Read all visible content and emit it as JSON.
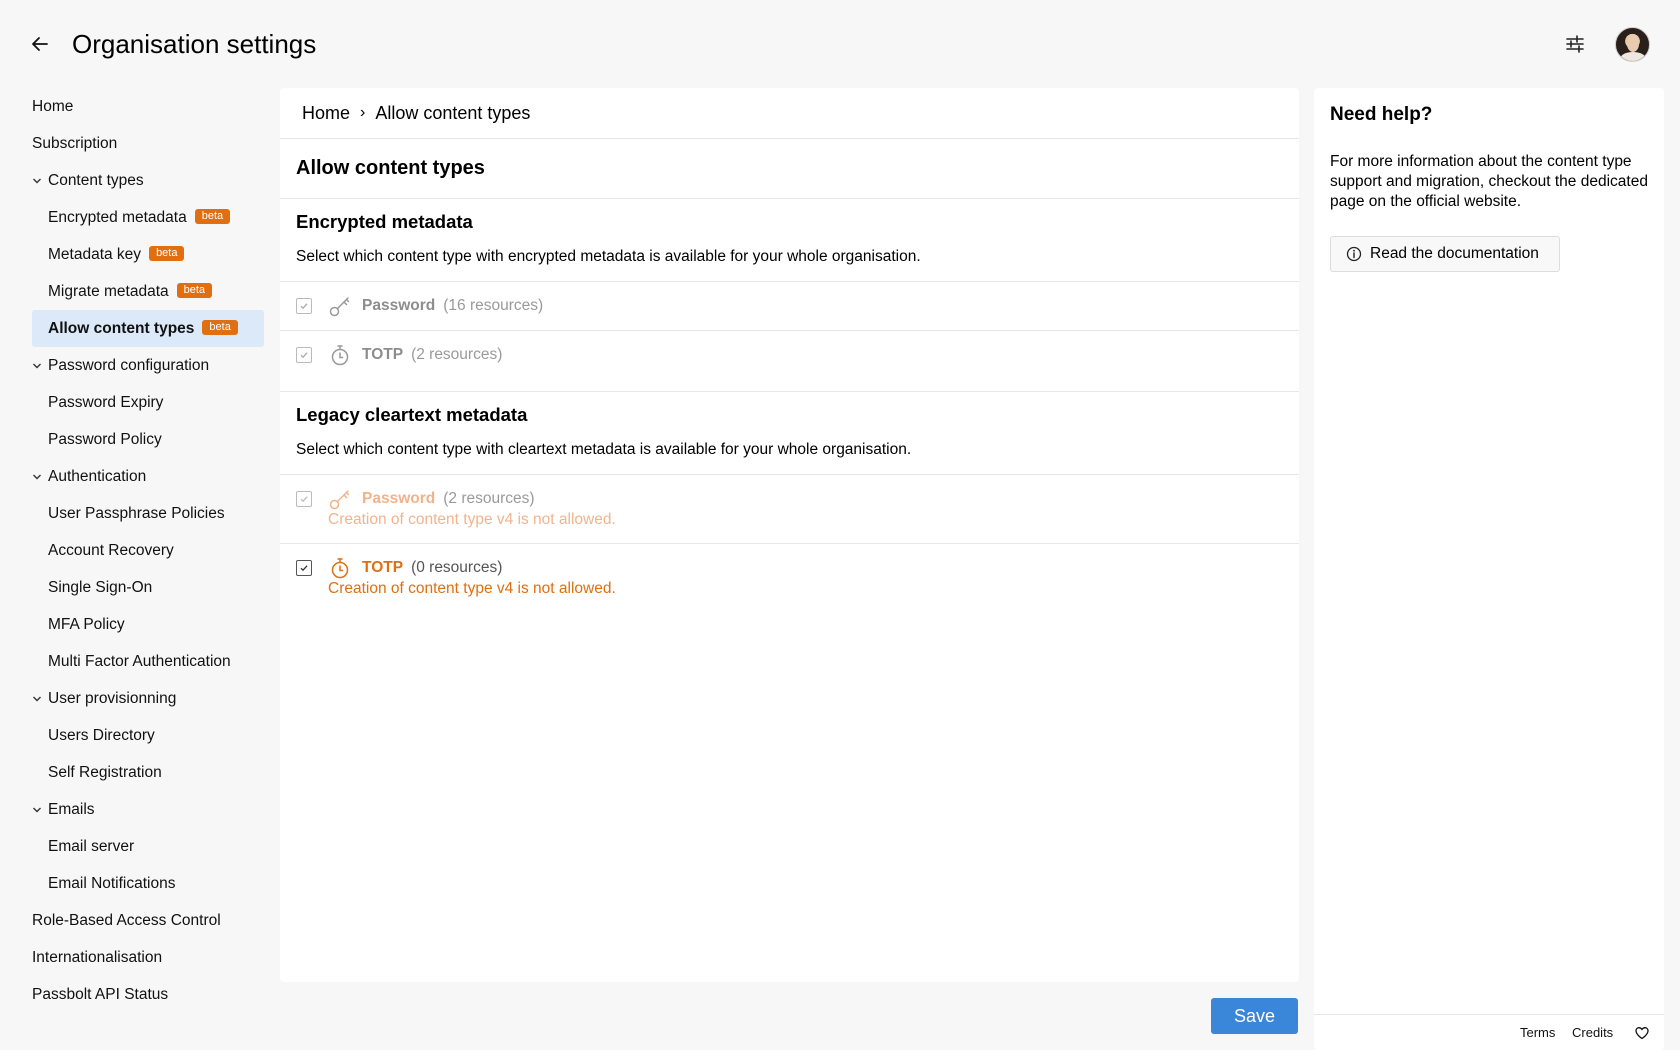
{
  "header": {
    "title": "Organisation settings"
  },
  "sidebar": {
    "home": "Home",
    "subscription": "Subscription",
    "content_types": {
      "label": "Content types",
      "items": [
        {
          "label": "Encrypted metadata",
          "badge": "beta"
        },
        {
          "label": "Metadata key",
          "badge": "beta"
        },
        {
          "label": "Migrate metadata",
          "badge": "beta"
        },
        {
          "label": "Allow content types",
          "badge": "beta",
          "active": true
        }
      ]
    },
    "password_configuration": {
      "label": "Password configuration",
      "items": [
        "Password Expiry",
        "Password Policy"
      ]
    },
    "authentication": {
      "label": "Authentication",
      "items": [
        "User Passphrase Policies",
        "Account Recovery",
        "Single Sign-On",
        "MFA Policy",
        "Multi Factor Authentication"
      ]
    },
    "user_provisionning": {
      "label": "User provisionning",
      "items": [
        "Users Directory",
        "Self Registration"
      ]
    },
    "emails": {
      "label": "Emails",
      "items": [
        "Email server",
        "Email Notifications"
      ]
    },
    "rbac": "Role-Based Access Control",
    "internationalisation": "Internationalisation",
    "api_status": "Passbolt API Status"
  },
  "main": {
    "breadcrumb": {
      "home": "Home",
      "separator": "›",
      "current": "Allow content types"
    },
    "title": "Allow content types",
    "encrypted": {
      "heading": "Encrypted metadata",
      "description": "Select which content type with encrypted metadata is available for your whole organisation.",
      "password": {
        "label": "Password",
        "count": "(16 resources)"
      },
      "totp": {
        "label": "TOTP",
        "count": "(2 resources)"
      }
    },
    "legacy": {
      "heading": "Legacy cleartext metadata",
      "description": "Select which content type with cleartext metadata is available for your whole organisation.",
      "password": {
        "label": "Password",
        "count": "(2 resources)",
        "error": "Creation of content type v4 is not allowed."
      },
      "totp": {
        "label": "TOTP",
        "count": "(0 resources)",
        "error": "Creation of content type v4 is not allowed."
      }
    }
  },
  "help": {
    "title": "Need help?",
    "text": "For more information about the content type support and migration, checkout the dedicated page on the official website.",
    "button": "Read the documentation",
    "footer": {
      "terms": "Terms",
      "credits": "Credits"
    }
  },
  "actions": {
    "save": "Save"
  },
  "colors": {
    "accent": "#3a86d8",
    "warning": "#e06f12",
    "active_bg": "#dce9f8"
  }
}
